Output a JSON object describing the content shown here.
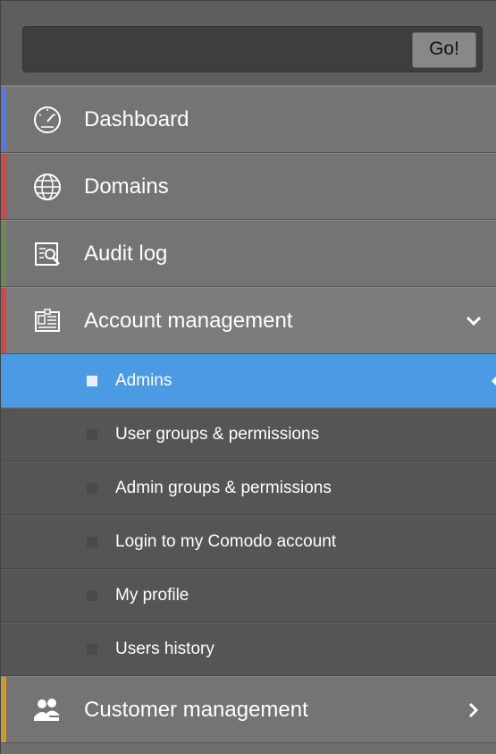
{
  "search": {
    "placeholder": "",
    "value": "",
    "go_label": "Go!"
  },
  "menu": {
    "items": [
      {
        "label": "Dashboard",
        "icon": "dashboard-icon",
        "accent": "#5b79c8"
      },
      {
        "label": "Domains",
        "icon": "globe-icon",
        "accent": "#c05050"
      },
      {
        "label": "Audit log",
        "icon": "audit-log-icon",
        "accent": "#6b8a5a"
      },
      {
        "label": "Account management",
        "icon": "account-card-icon",
        "accent": "#c05050",
        "expanded": true
      },
      {
        "label": "Customer management",
        "icon": "customers-icon",
        "accent": "#c89a40",
        "expanded": false
      }
    ],
    "account_submenu": [
      {
        "label": "Admins",
        "active": true
      },
      {
        "label": "User groups & permissions"
      },
      {
        "label": "Admin groups & permissions"
      },
      {
        "label": "Login to my Comodo account"
      },
      {
        "label": "My profile"
      },
      {
        "label": "Users history"
      }
    ]
  },
  "colors": {
    "active_item": "#4a9be3",
    "menu_background": "#747474",
    "submenu_background": "#555555"
  }
}
